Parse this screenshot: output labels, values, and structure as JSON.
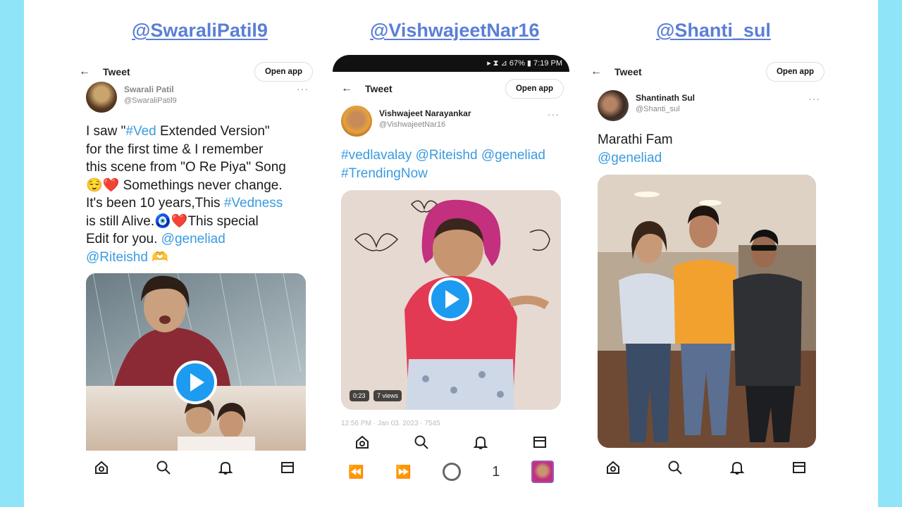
{
  "columns": [
    {
      "handle": "@SwaraliPatil9",
      "topbar": {
        "title": "Tweet",
        "open_app": "Open app"
      },
      "author": {
        "display_name": "Swarali Patil",
        "username": "@SwaraliPatil9"
      },
      "text": {
        "l1a": "I saw \"",
        "l1b": "#Ved",
        "l1c": " Extended Version\"",
        "l2": "for the first time & I remember",
        "l3": "this scene from \"O Re Piya\" Song",
        "l4": "😌❤️ Somethings never change.",
        "l5a": "It's been 10 years,This ",
        "l5b": "#Vedness",
        "l6a": "is still Alive.🧿❤️This special",
        "l7a": "Edit for you. ",
        "l7b": "@geneliad",
        "l8a": "@Riteishd",
        "l8b": " 🫶"
      }
    },
    {
      "handle": "@VishwajeetNar16",
      "status_bar": "▸ ⧗ ⊿ 67% ▮ 7:19 PM",
      "topbar": {
        "title": "Tweet",
        "open_app": "Open app"
      },
      "author": {
        "display_name": "Vishwajeet Narayankar",
        "username": "@VishwajeetNar16"
      },
      "text": {
        "l1": "#vedlavalay @Riteishd @geneliad",
        "l2": "#TrendingNow"
      },
      "media": {
        "duration": "0:23",
        "views": "7 views"
      },
      "timestamp": "12:56 PM · Jan 03, 2023 · 7545",
      "system_nav": {
        "page": "1"
      }
    },
    {
      "handle": "@Shanti_sul",
      "topbar": {
        "title": "Tweet",
        "open_app": "Open app"
      },
      "author": {
        "display_name": "Shantinath Sul",
        "username": "@Shanti_sul"
      },
      "text": {
        "l1": "Marathi Fam",
        "l2": "@geneliad"
      }
    }
  ],
  "icons": {
    "nav": [
      "home-icon",
      "search-icon",
      "bell-icon",
      "mail-icon"
    ],
    "system": [
      "rewind-icon",
      "forward-icon",
      "circle-icon",
      "avatar-thumb"
    ]
  },
  "colors": {
    "background": "#8fe4f7",
    "handle": "#5b7fd6",
    "link": "#3a9be0",
    "play": "#1d9bf0"
  }
}
